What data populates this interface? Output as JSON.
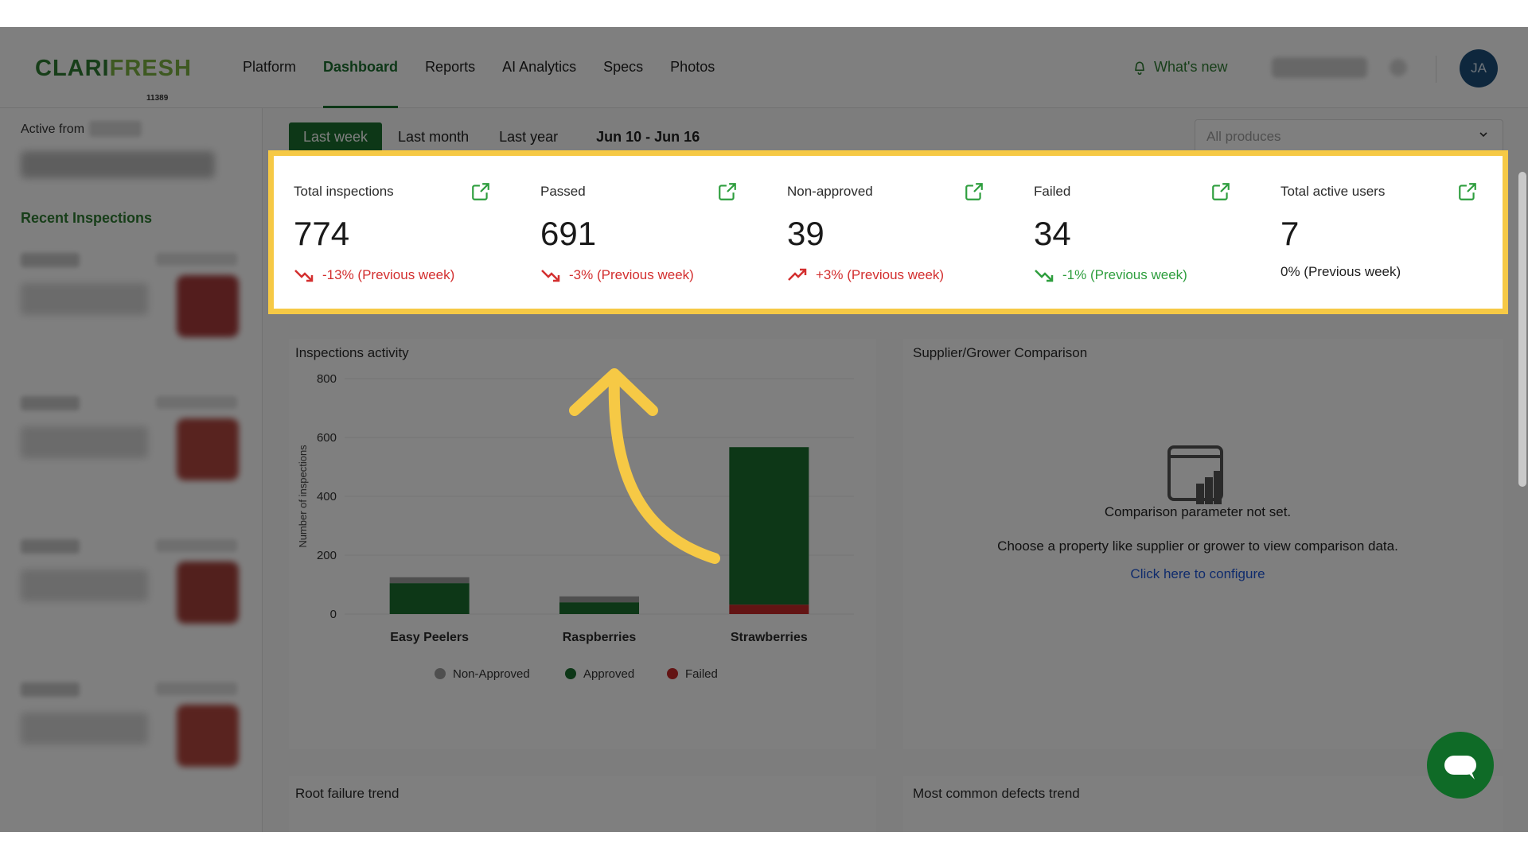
{
  "brand": {
    "logo_part1": "CLARI",
    "logo_part2": "FRESH",
    "sub": "11389"
  },
  "nav": {
    "items": [
      "Platform",
      "Dashboard",
      "Reports",
      "AI Analytics",
      "Specs",
      "Photos"
    ],
    "active": "Dashboard"
  },
  "header": {
    "whats_new": "What's new",
    "avatar_initials": "JA"
  },
  "sidebar": {
    "active_from_label": "Active from",
    "recent_inspections_title": "Recent Inspections"
  },
  "date_range": {
    "tabs": [
      "Last week",
      "Last month",
      "Last year"
    ],
    "active": "Last week",
    "range_label": "Jun 10 - Jun 16"
  },
  "produce_filter": {
    "placeholder": "All produces"
  },
  "stats": [
    {
      "title": "Total inspections",
      "value": "774",
      "trend": "-13% (Previous week)",
      "trend_dir": "down",
      "trend_color": "red"
    },
    {
      "title": "Passed",
      "value": "691",
      "trend": "-3% (Previous week)",
      "trend_dir": "down",
      "trend_color": "red"
    },
    {
      "title": "Non-approved",
      "value": "39",
      "trend": "+3% (Previous week)",
      "trend_dir": "up",
      "trend_color": "red"
    },
    {
      "title": "Failed",
      "value": "34",
      "trend": "-1% (Previous week)",
      "trend_dir": "down",
      "trend_color": "green"
    },
    {
      "title": "Total active users",
      "value": "7",
      "trend": "0% (Previous week)",
      "trend_dir": "none",
      "trend_color": "plain"
    }
  ],
  "inspections_activity": {
    "title": "Inspections activity",
    "chart_data": {
      "type": "bar",
      "stacked": true,
      "categories": [
        "Easy Peelers",
        "Raspberries",
        "Strawberries"
      ],
      "series": [
        {
          "name": "Non-Approved",
          "color": "#9e9e9e",
          "values": [
            20,
            20,
            0
          ]
        },
        {
          "name": "Approved",
          "color": "#1b6e2e",
          "values": [
            105,
            40,
            535
          ]
        },
        {
          "name": "Failed",
          "color": "#c62828",
          "values": [
            0,
            0,
            32
          ]
        }
      ],
      "ylabel": "Number of inspections",
      "ylim": [
        0,
        800
      ],
      "yticks": [
        0,
        200,
        400,
        600,
        800
      ],
      "legend": "bottom"
    }
  },
  "comparison": {
    "title": "Supplier/Grower Comparison",
    "message_title": "Comparison parameter not set.",
    "message_body": "Choose a property like supplier or grower to view comparison data.",
    "link": "Click here to configure"
  },
  "lower_panels": {
    "left_title": "Root failure trend",
    "right_title": "Most common defects trend"
  }
}
